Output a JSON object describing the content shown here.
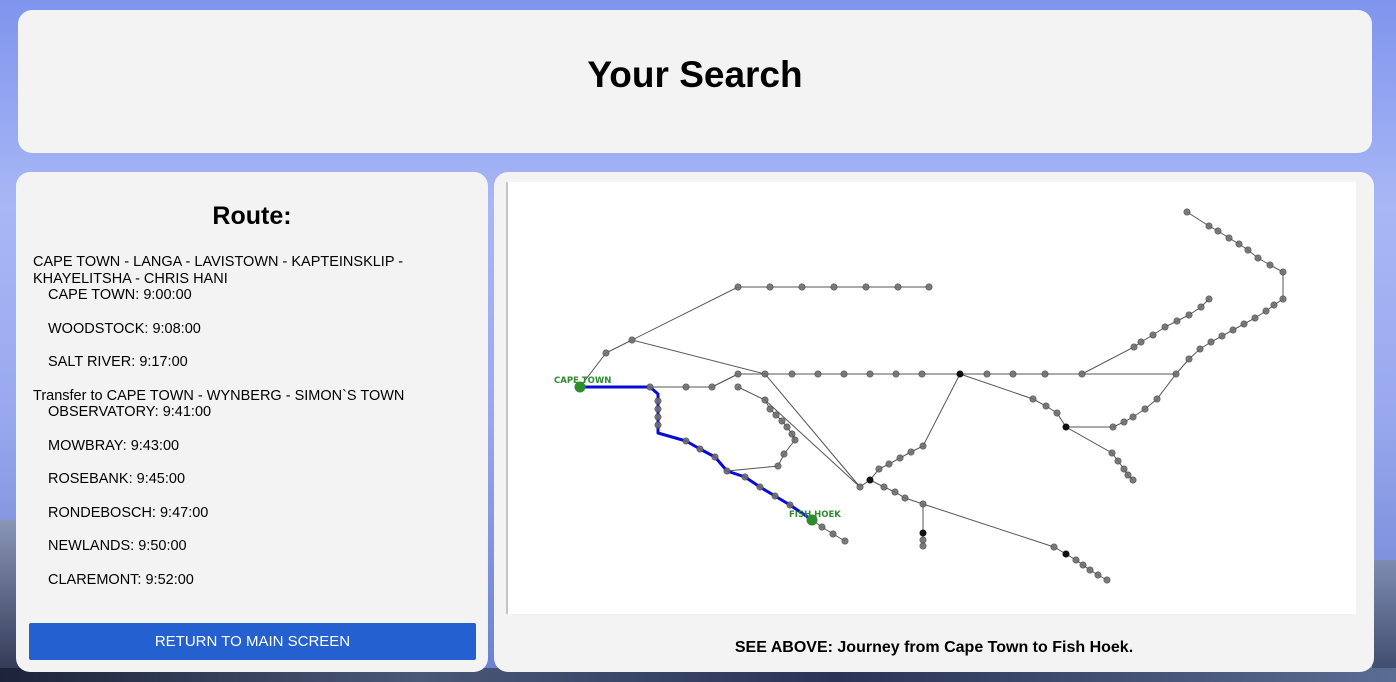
{
  "header": {
    "title": "Your Search"
  },
  "route": {
    "title": "Route:",
    "segments": [
      {
        "line": "CAPE TOWN - LANGA - LAVISTOWN - KAPTEINSKLIP - KHAYELITSHA - CHRIS HANI",
        "stops": [
          "CAPE TOWN: 9:00:00",
          "WOODSTOCK: 9:08:00",
          "SALT RIVER: 9:17:00"
        ]
      },
      {
        "line": "Transfer to CAPE TOWN - WYNBERG - SIMON`S TOWN",
        "stops": [
          "OBSERVATORY: 9:41:00",
          "MOWBRAY: 9:43:00",
          "ROSEBANK: 9:45:00",
          "RONDEBOSCH: 9:47:00",
          "NEWLANDS: 9:50:00",
          "CLAREMONT: 9:52:00"
        ]
      }
    ],
    "return_button": "RETURN TO MAIN SCREEN"
  },
  "map": {
    "origin_label": "CAPE TOWN",
    "destination_label": "FISH HOEK",
    "caption": "SEE ABOVE: Journey from Cape Town to Fish Hoek.",
    "colors": {
      "route": "#0b0bd6",
      "station": "#6e6e6e",
      "junction": "#111111",
      "endpoint": "#2e8b2e",
      "line": "#555555"
    }
  }
}
